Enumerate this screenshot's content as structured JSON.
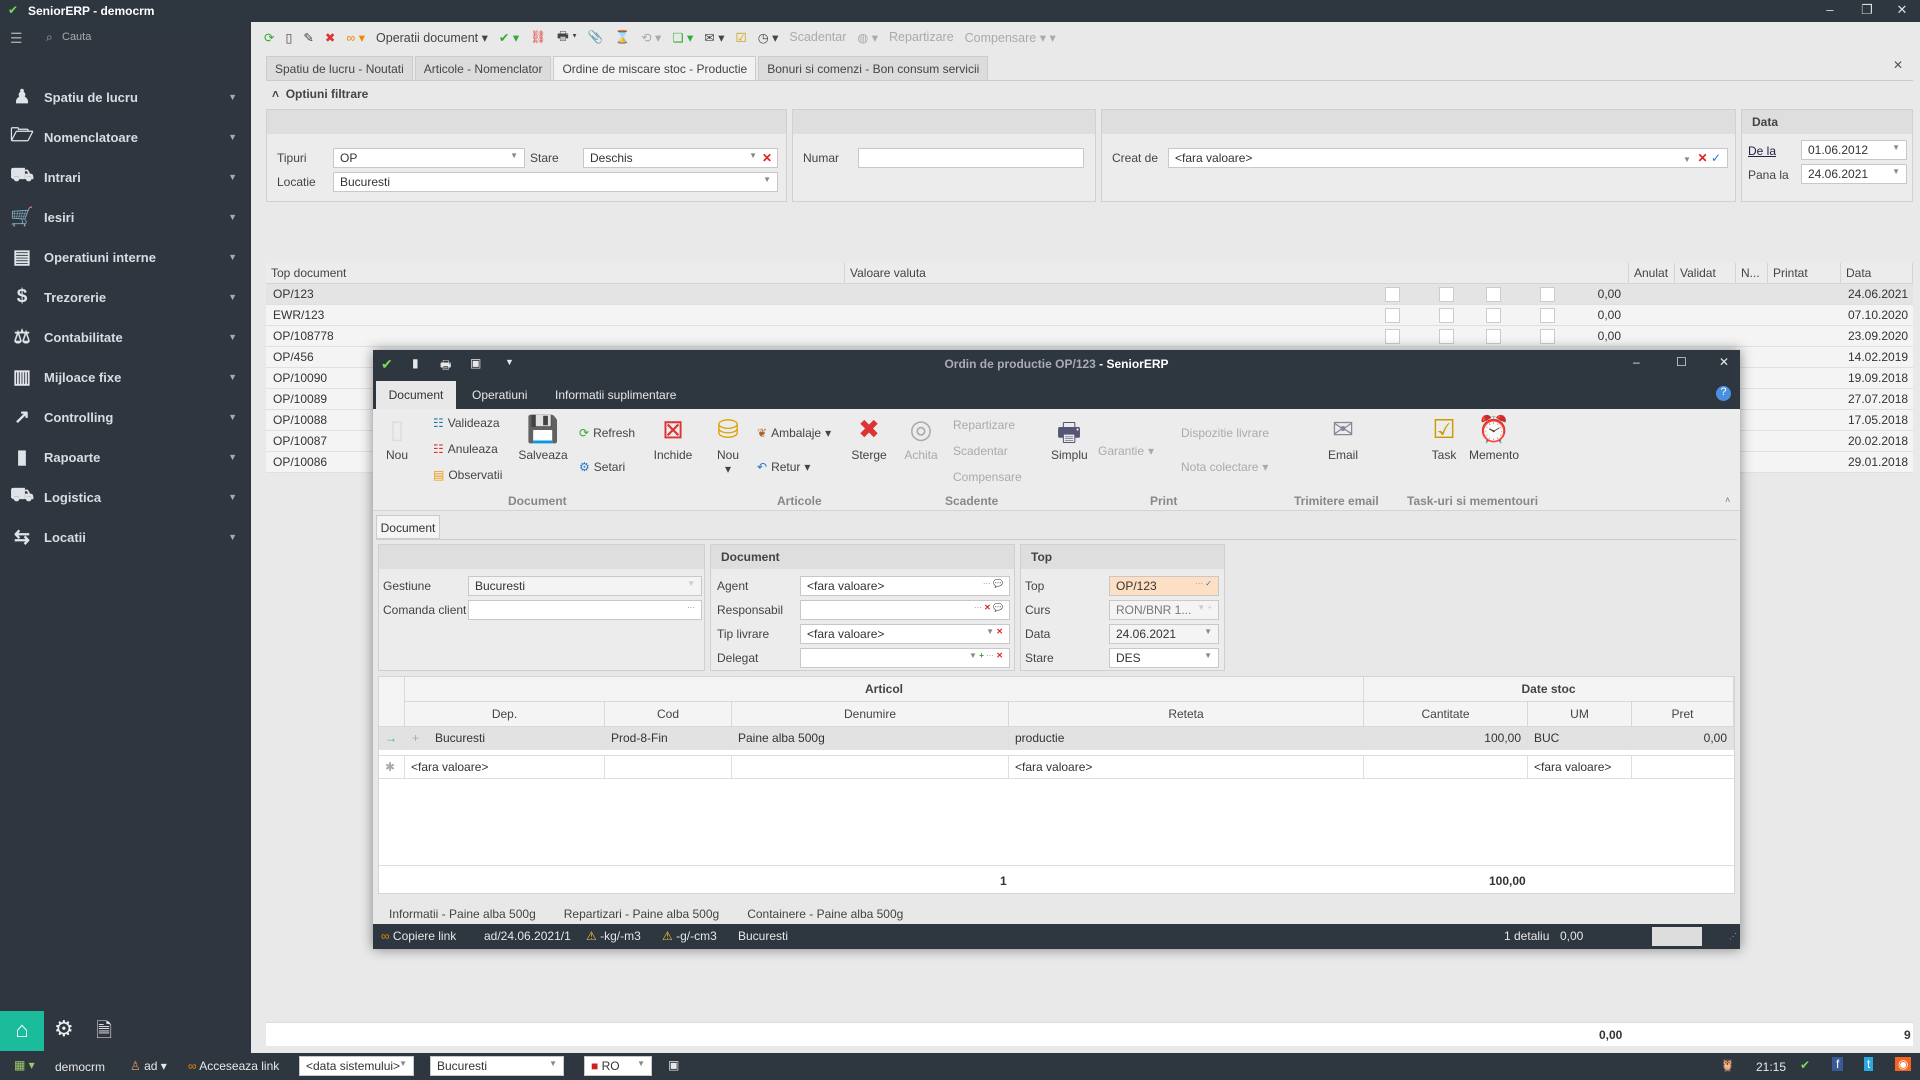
{
  "app": {
    "title": "SeniorERP - democrm"
  },
  "sidebar": {
    "search_placeholder": "Cauta",
    "items": [
      {
        "label": "Spatiu de lucru",
        "icon": "person-icon",
        "glyph": "♟"
      },
      {
        "label": "Nomenclatoare",
        "icon": "folder-icon",
        "glyph": "🗁"
      },
      {
        "label": "Intrari",
        "icon": "cart-in-icon",
        "glyph": "⛟"
      },
      {
        "label": "Iesiri",
        "icon": "cart-icon",
        "glyph": "🛒"
      },
      {
        "label": "Operatiuni interne",
        "icon": "building-icon",
        "glyph": "▤"
      },
      {
        "label": "Trezorerie",
        "icon": "coins-icon",
        "glyph": "$"
      },
      {
        "label": "Contabilitate",
        "icon": "scale-icon",
        "glyph": "⚖"
      },
      {
        "label": "Mijloace fixe",
        "icon": "building-icon",
        "glyph": "▥"
      },
      {
        "label": "Controlling",
        "icon": "chart-line-icon",
        "glyph": "↗"
      },
      {
        "label": "Rapoarte",
        "icon": "bar-chart-icon",
        "glyph": "▮"
      },
      {
        "label": "Logistica",
        "icon": "truck-icon",
        "glyph": "⛟"
      },
      {
        "label": "Locatii",
        "icon": "signpost-icon",
        "glyph": "⇆"
      }
    ]
  },
  "toolbar": {
    "operatii": "Operatii document",
    "scadentar": "Scadentar",
    "repartizare": "Repartizare",
    "compensare": "Compensare"
  },
  "tabs": [
    "Spatiu de lucru - Noutati",
    "Articole - Nomenclator",
    "Ordine de miscare stoc - Productie",
    "Bonuri si comenzi - Bon consum servicii"
  ],
  "filter": {
    "title": "Optiuni filtrare",
    "tipuri_label": "Tipuri",
    "tipuri": "OP",
    "stare_label": "Stare",
    "stare": "Deschis",
    "locatie_label": "Locatie",
    "locatie": "Bucuresti",
    "numar_label": "Numar",
    "numar": "",
    "creat_label": "Creat de",
    "creat": "<fara valoare>",
    "data_title": "Data",
    "dela_label": "De la",
    "dela": "01.06.2012",
    "panala_label": "Pana la",
    "panala": "24.06.2021"
  },
  "grid": {
    "headers": [
      "Top document",
      "Valoare valuta",
      "Anulat",
      "Validat",
      "N...",
      "Printat",
      "Data"
    ],
    "rows": [
      {
        "doc": "OP/123",
        "val": "0,00",
        "date": "24.06.2021"
      },
      {
        "doc": "EWR/123",
        "val": "0,00",
        "date": "07.10.2020"
      },
      {
        "doc": "OP/108778",
        "val": "0,00",
        "date": "23.09.2020"
      },
      {
        "doc": "OP/456",
        "val": "",
        "date": "14.02.2019"
      },
      {
        "doc": "OP/10090",
        "val": "",
        "date": "19.09.2018"
      },
      {
        "doc": "OP/10089",
        "val": "",
        "date": "27.07.2018"
      },
      {
        "doc": "OP/10088",
        "val": "",
        "date": "17.05.2018"
      },
      {
        "doc": "OP/10087",
        "val": "",
        "date": "20.02.2018"
      },
      {
        "doc": "OP/10086",
        "val": "",
        "date": "29.01.2018"
      }
    ],
    "footer_total": "0,00",
    "footer_count": "9"
  },
  "modal": {
    "title": "Ordin de productie OP/123",
    "title_app": " - SeniorERP",
    "tabs": [
      "Document",
      "Operatiuni",
      "Informatii suplimentare"
    ],
    "ribbon": {
      "nou": "Nou",
      "valideaza": "Valideaza",
      "anuleaza": "Anuleaza",
      "observatii": "Observatii",
      "salveaza": "Salveaza",
      "refresh": "Refresh",
      "setari": "Setari",
      "inchide": "Inchide",
      "nou2": "Nou",
      "ambalaje": "Ambalaje",
      "retur": "Retur",
      "sterge": "Sterge",
      "achita": "Achita",
      "repartizare": "Repartizare",
      "scadentar": "Scadentar",
      "compensare": "Compensare",
      "simplu": "Simplu",
      "garantie": "Garantie",
      "dispozitie": "Dispozitie livrare",
      "nota": "Nota colectare",
      "email": "Email",
      "task": "Task",
      "memento": "Memento",
      "groups": [
        "Document",
        "Articole",
        "Scadente",
        "Print",
        "Trimitere email",
        "Task-uri si mementouri"
      ]
    },
    "subtab": "Document",
    "form": {
      "gestiune_label": "Gestiune",
      "gestiune": "Bucuresti",
      "comanda_label": "Comanda client",
      "comanda": "",
      "doc_title": "Document",
      "agent_label": "Agent",
      "agent": "<fara valoare>",
      "resp_label": "Responsabil",
      "resp": "",
      "tip_label": "Tip livrare",
      "tip": "<fara valoare>",
      "delegat_label": "Delegat",
      "delegat": "",
      "top_title": "Top",
      "top_label": "Top",
      "top": "OP/123",
      "curs_label": "Curs",
      "curs": "RON/BNR 1...",
      "data_label": "Data",
      "data": "24.06.2021",
      "stare_label": "Stare",
      "stare": "DES"
    },
    "grid": {
      "band_articol": "Articol",
      "band_stoc": "Date stoc",
      "headers": [
        "Dep.",
        "Cod",
        "Denumire",
        "Reteta",
        "Cantitate",
        "UM",
        "Pret"
      ],
      "row": [
        "Bucuresti",
        "Prod-8-Fin",
        "Paine alba 500g",
        "productie",
        "100,00",
        "BUC",
        "0,00"
      ],
      "new_row": {
        "dep": "<fara valoare>",
        "reteta": "<fara valoare>",
        "um": "<fara valoare>"
      },
      "footer_count": "1",
      "footer_qty": "100,00"
    },
    "detail_tabs": [
      "Informatii - Paine alba 500g",
      "Repartizari - Paine alba 500g",
      "Containere - Paine alba 500g"
    ],
    "status": {
      "copy": "Copiere link",
      "user": "ad/24.06.2021/1",
      "kg": "-kg/-m3",
      "g": "-g/-cm3",
      "loc": "Bucuresti",
      "detalii": "1 detaliu",
      "val": "0,00"
    }
  },
  "taskbar": {
    "db": "democrm",
    "user": "ad",
    "link": "Acceseaza link",
    "data_sys": "<data sistemului>",
    "loc": "Bucuresti",
    "lang": "RO",
    "time": "21:15"
  },
  "colors": {
    "dark": "#2e3640",
    "accent": "#1abc9c",
    "top_field": "#fde0c4"
  }
}
